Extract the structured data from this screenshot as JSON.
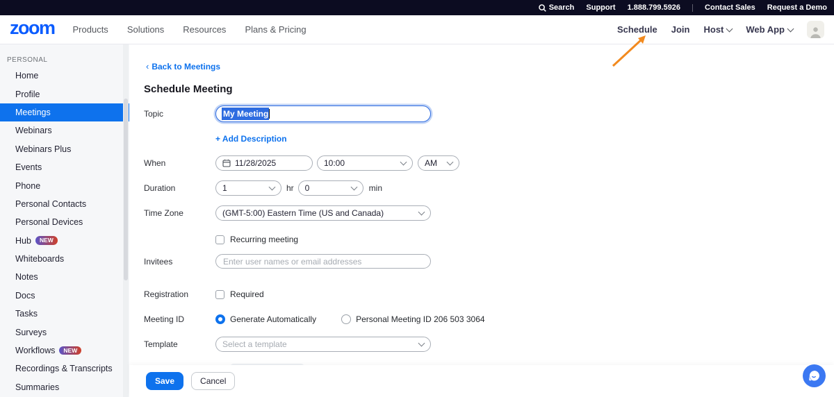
{
  "topbar": {
    "search": "Search",
    "support": "Support",
    "phone": "1.888.799.5926",
    "contact_sales": "Contact Sales",
    "request_demo": "Request a Demo"
  },
  "nav": {
    "logo": "zoom",
    "links": [
      "Products",
      "Solutions",
      "Resources",
      "Plans & Pricing"
    ],
    "schedule": "Schedule",
    "join": "Join",
    "host": "Host",
    "web_app": "Web App"
  },
  "sidebar": {
    "section": "PERSONAL",
    "items": [
      {
        "label": "Home"
      },
      {
        "label": "Profile"
      },
      {
        "label": "Meetings",
        "active": true
      },
      {
        "label": "Webinars"
      },
      {
        "label": "Webinars Plus"
      },
      {
        "label": "Events"
      },
      {
        "label": "Phone"
      },
      {
        "label": "Personal Contacts"
      },
      {
        "label": "Personal Devices"
      },
      {
        "label": "Hub",
        "badge": "NEW"
      },
      {
        "label": "Whiteboards"
      },
      {
        "label": "Notes"
      },
      {
        "label": "Docs"
      },
      {
        "label": "Tasks"
      },
      {
        "label": "Surveys"
      },
      {
        "label": "Workflows",
        "badge": "NEW"
      },
      {
        "label": "Recordings & Transcripts"
      },
      {
        "label": "Summaries"
      }
    ]
  },
  "main": {
    "back_chevron": "‹",
    "back_link": "Back to Meetings",
    "title": "Schedule Meeting",
    "form": {
      "topic_label": "Topic",
      "topic_value": "My Meeting",
      "add_description": "+  Add Description",
      "when_label": "When",
      "date_value": "11/28/2025",
      "time_value": "10:00",
      "ampm_value": "AM",
      "duration_label": "Duration",
      "duration_hr_value": "1",
      "hr_label": "hr",
      "duration_min_value": "0",
      "min_label": "min",
      "timezone_label": "Time Zone",
      "timezone_value": "(GMT-5:00) Eastern Time (US and Canada)",
      "recurring_label": "Recurring meeting",
      "invitees_label": "Invitees",
      "invitees_placeholder": "Enter user names or email addresses",
      "registration_label": "Registration",
      "required_label": "Required",
      "meeting_id_label": "Meeting ID",
      "generate_auto_label": "Generate Automatically",
      "pmi_label": "Personal Meeting ID 206 503 3064",
      "template_label": "Template",
      "template_placeholder": "Select a template"
    },
    "footer": {
      "save_label": "Save",
      "cancel_label": "Cancel"
    }
  },
  "icons": {
    "search": "magnifier-glyph",
    "calendar": "calendar-glyph",
    "chevron_down": "chevron-down-glyph",
    "back": "chevron-left-glyph",
    "avatar": "person-silhouette",
    "chat": "chat-bubble-smile",
    "annotation": "orange-arrow-to-schedule"
  },
  "colors": {
    "accent_blue": "#0e72ed",
    "logo_blue": "#0b5cff",
    "topbar_bg": "#0c0c21",
    "selection_blue": "#2e6ce0",
    "badge_gradient_start": "#5a54c8",
    "badge_gradient_end": "#cf4029",
    "annotation_arrow": "#f28a1f",
    "chat_fab": "#3b78f2",
    "sidebar_bg": "#f6f7f9"
  }
}
